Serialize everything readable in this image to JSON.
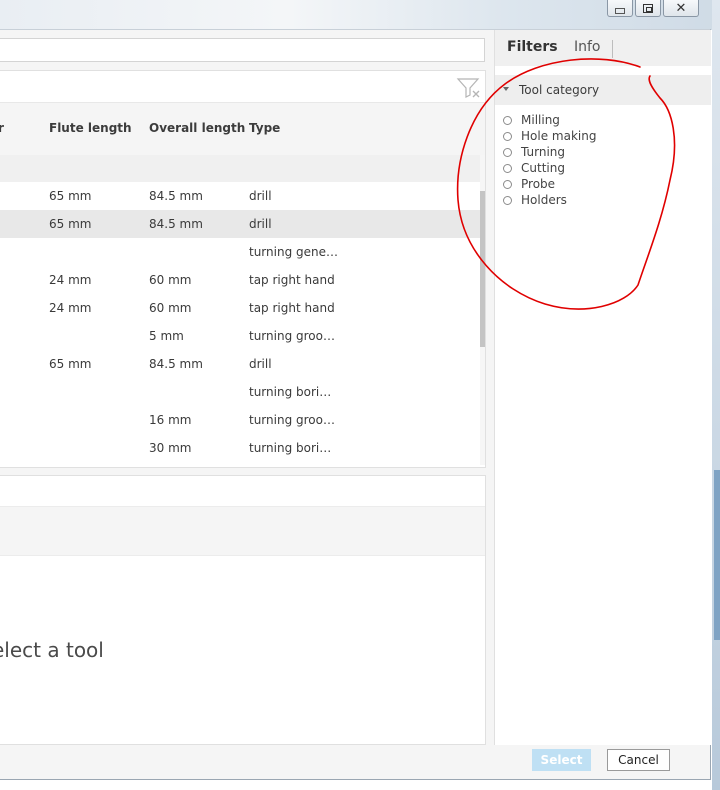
{
  "window": {
    "controls": [
      {
        "name": "minimize",
        "icon": "minimize-icon"
      },
      {
        "name": "restore",
        "icon": "restore-icon"
      },
      {
        "name": "close",
        "icon": "close-icon",
        "glyph": "✕"
      }
    ]
  },
  "search": {
    "value": ""
  },
  "tool_list": {
    "columns": {
      "partial": "r",
      "flute_length": "Flute length",
      "overall_length": "Overall length",
      "type": "Type"
    },
    "rows": [
      {
        "flute": "65 mm",
        "overall": "84.5 mm",
        "type": "drill",
        "selected": false
      },
      {
        "flute": "65 mm",
        "overall": "84.5 mm",
        "type": "drill",
        "selected": true
      },
      {
        "flute": "",
        "overall": "",
        "type": "turning gene…",
        "selected": false
      },
      {
        "flute": "24 mm",
        "overall": "60 mm",
        "type": "tap right hand",
        "selected": false
      },
      {
        "flute": "24 mm",
        "overall": "60 mm",
        "type": "tap right hand",
        "selected": false
      },
      {
        "flute": "",
        "overall": "5 mm",
        "type": "turning groo…",
        "selected": false
      },
      {
        "flute": "65 mm",
        "overall": "84.5 mm",
        "type": "drill",
        "selected": false
      },
      {
        "flute": "",
        "overall": "",
        "type": "turning bori…",
        "selected": false
      },
      {
        "flute": "",
        "overall": "16 mm",
        "type": "turning groo…",
        "selected": false
      },
      {
        "flute": "",
        "overall": "30 mm",
        "type": "turning bori…",
        "selected": false
      }
    ]
  },
  "preview": {
    "message": "elect a tool"
  },
  "side_panel": {
    "tabs": {
      "filters": "Filters",
      "info": "Info"
    },
    "section_title": "Tool category",
    "options": [
      "Milling",
      "Hole making",
      "Turning",
      "Cutting",
      "Probe",
      "Holders"
    ]
  },
  "footer": {
    "select_label": "Select",
    "cancel_label": "Cancel"
  },
  "colors": {
    "annotation": "#e00000",
    "select_button": "#bfe0f4"
  }
}
